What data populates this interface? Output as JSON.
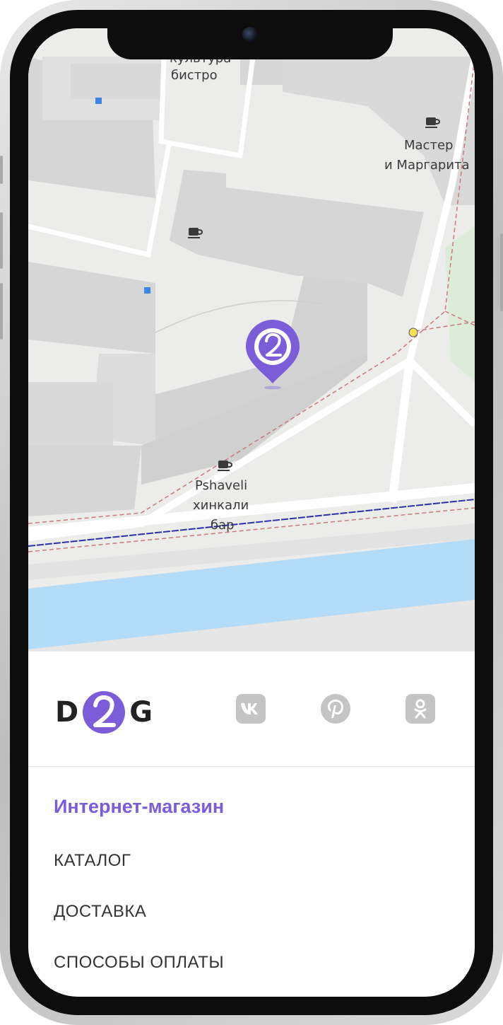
{
  "map": {
    "labels": {
      "bistro_partial": "культура",
      "bistro": "бистро",
      "master_line1": "Мастер",
      "master_line2": "и Маргарита",
      "pshaveli_line1": "Pshaveli",
      "pshaveli_line2": "хинкали",
      "pshaveli_line3": "бар"
    },
    "colors": {
      "background": "#ECECEA",
      "building": "#D6D6D6",
      "road": "#FFFFFF",
      "water": "#B4DBF7",
      "park": "#DDEBD9",
      "pin": "#7B5CD9"
    },
    "icons": [
      "cafe-icon",
      "cafe-icon",
      "cafe-icon",
      "map-pin-icon"
    ]
  },
  "footer": {
    "logo": {
      "left": "D",
      "right": "G",
      "mark": "2"
    },
    "social": [
      "vk-icon",
      "pinterest-icon",
      "odnoklassniki-icon"
    ]
  },
  "menu": {
    "title": "Интернет-магазин",
    "items": [
      "КАТАЛОГ",
      "ДОСТАВКА",
      "СПОСОБЫ ОПЛАТЫ"
    ]
  },
  "colors": {
    "accent": "#7B5CD9",
    "icon_gray": "#C4C4C4",
    "text": "#333333"
  }
}
